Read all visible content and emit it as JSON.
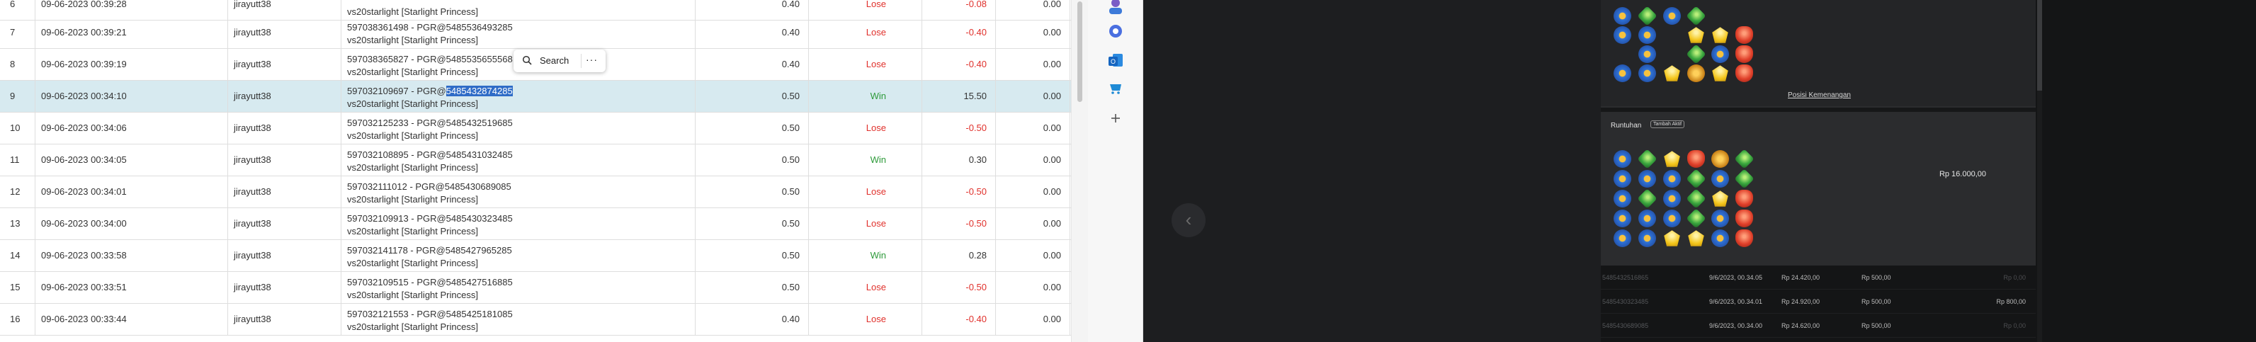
{
  "table": {
    "rows": [
      {
        "no": "6",
        "time": "09-06-2023 00:39:28",
        "user": "jirayutt38",
        "detail1": "",
        "detail2": "vs20starlight [Starlight Princess]",
        "bet": "0.40",
        "result": "Lose",
        "win": "-0.08",
        "jp": "0.00"
      },
      {
        "no": "7",
        "time": "09-06-2023 00:39:21",
        "user": "jirayutt38",
        "detail1": "597038361498 - PGR@5485536493285",
        "detail2": "vs20starlight [Starlight Princess]",
        "bet": "0.40",
        "result": "Lose",
        "win": "-0.40",
        "jp": "0.00"
      },
      {
        "no": "8",
        "time": "09-06-2023 00:39:19",
        "user": "jirayutt38",
        "detail1": "597038365827 - PGR@5485535655568",
        "detail2": "vs20starlight [Starlight Princess]",
        "bet": "0.40",
        "result": "Lose",
        "win": "-0.40",
        "jp": "0.00"
      },
      {
        "no": "9",
        "time": "09-06-2023 00:34:10",
        "user": "jirayutt38",
        "detail1a": "597032109697 - PGR@",
        "detail1b": "5485432874285",
        "detail2": "vs20starlight [Starlight Princess]",
        "bet": "0.50",
        "result": "Win",
        "win": "15.50",
        "jp": "0.00"
      },
      {
        "no": "10",
        "time": "09-06-2023 00:34:06",
        "user": "jirayutt38",
        "detail1": "597032125233 - PGR@5485432519685",
        "detail2": "vs20starlight [Starlight Princess]",
        "bet": "0.50",
        "result": "Lose",
        "win": "-0.50",
        "jp": "0.00"
      },
      {
        "no": "11",
        "time": "09-06-2023 00:34:05",
        "user": "jirayutt38",
        "detail1": "597032108895 - PGR@5485431032485",
        "detail2": "vs20starlight [Starlight Princess]",
        "bet": "0.50",
        "result": "Win",
        "win": "0.30",
        "jp": "0.00"
      },
      {
        "no": "12",
        "time": "09-06-2023 00:34:01",
        "user": "jirayutt38",
        "detail1": "597032111012 - PGR@5485430689085",
        "detail2": "vs20starlight [Starlight Princess]",
        "bet": "0.50",
        "result": "Lose",
        "win": "-0.50",
        "jp": "0.00"
      },
      {
        "no": "13",
        "time": "09-06-2023 00:34:00",
        "user": "jirayutt38",
        "detail1": "597032109913 - PGR@5485430323485",
        "detail2": "vs20starlight [Starlight Princess]",
        "bet": "0.50",
        "result": "Lose",
        "win": "-0.50",
        "jp": "0.00"
      },
      {
        "no": "14",
        "time": "09-06-2023 00:33:58",
        "user": "jirayutt38",
        "detail1": "597032141178 - PGR@5485427965285",
        "detail2": "vs20starlight [Starlight Princess]",
        "bet": "0.50",
        "result": "Win",
        "win": "0.28",
        "jp": "0.00"
      },
      {
        "no": "15",
        "time": "09-06-2023 00:33:51",
        "user": "jirayutt38",
        "detail1": "597032109515 - PGR@5485427516885",
        "detail2": "vs20starlight [Starlight Princess]",
        "bet": "0.50",
        "result": "Lose",
        "win": "-0.50",
        "jp": "0.00"
      },
      {
        "no": "16",
        "time": "09-06-2023 00:33:44",
        "user": "jirayutt38",
        "detail1": "597032121553 - PGR@5485425181085",
        "detail2": "vs20starlight [Starlight Princess]",
        "bet": "0.40",
        "result": "Lose",
        "win": "-0.40",
        "jp": "0.00"
      }
    ]
  },
  "popup": {
    "search_label": "Search",
    "more_label": "···"
  },
  "game": {
    "posisi_link": "Posisi Kemenangan",
    "runtuhan_label": "Runtuhan",
    "badge_label": "Tambah Aktif",
    "win_amount": "Rp 16.000,00",
    "history": [
      {
        "id": "5485432516865",
        "time": "9/6/2023, 00.34.05",
        "balance": "Rp 24.420,00",
        "bet": "Rp 500,00",
        "win": "Rp 0,00"
      },
      {
        "id": "5485430323485",
        "time": "9/6/2023, 00.34.01",
        "balance": "Rp 24.920,00",
        "bet": "Rp 500,00",
        "win": "Rp 800,00"
      },
      {
        "id": "5485430689085",
        "time": "9/6/2023, 00.34.00",
        "balance": "Rp 24.620,00",
        "bet": "Rp 500,00",
        "win": "Rp 0,00"
      }
    ]
  },
  "colors": {
    "lose": "#e0302b",
    "win": "#2e9a3a",
    "selected_row": "#d7eaf0",
    "highlight": "#2f6cc7"
  }
}
